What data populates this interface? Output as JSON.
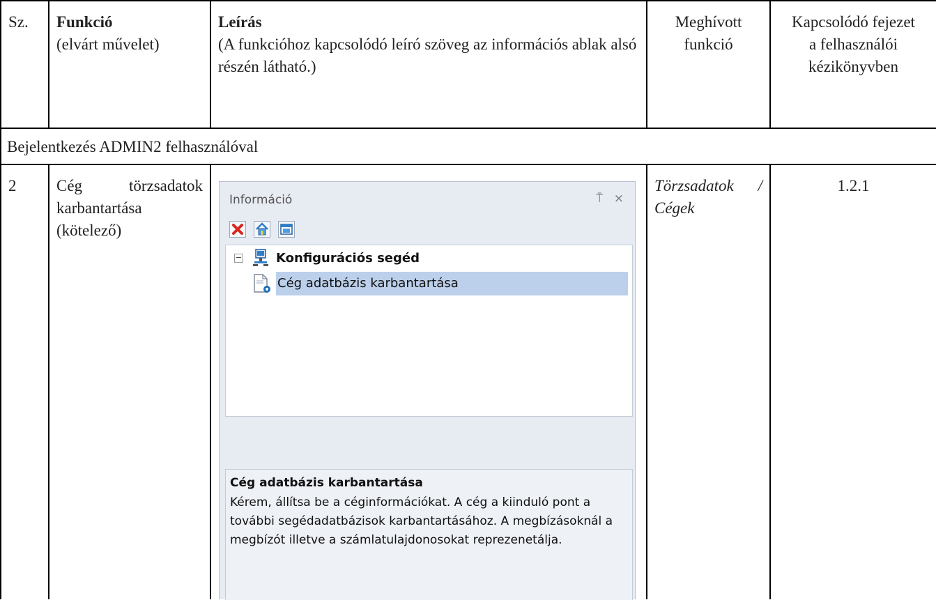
{
  "header": {
    "col_num": "Sz.",
    "col_function_title": "Funkció",
    "col_function_sub": "(elvárt művelet)",
    "col_desc_title": "Leírás",
    "col_desc_sub": "(A funkcióhoz kapcsolódó leíró szöveg az információs ablak alsó részén látható.)",
    "col_called": "Meghívott funkció",
    "col_chapter": "Kapcsolódó fejezet a felhasználói kézikönyvben"
  },
  "section_row": "Bejelentkezés ADMIN2 felhasználóval",
  "row": {
    "num": "2",
    "function_line1": "Cég törzsadatok",
    "function_line2": "karbantartása",
    "function_line3": "(kötelező)",
    "called_line1": "Törzsadatok /",
    "called_line2": "Cégek",
    "chapter": "1.2.1"
  },
  "panel": {
    "title": "Információ",
    "pin_glyph": "⍑",
    "close_glyph": "×",
    "toolbar_icons": [
      "delete-icon",
      "home-icon",
      "window-icon"
    ],
    "tree_root": "Konfigurációs segéd",
    "tree_child": "Cég adatbázis karbantartása",
    "expander_glyph": "−",
    "desc_title": "Cég adatbázis karbantartása",
    "desc_text": "Kérem, állítsa be a céginformációkat. A cég a kiinduló pont a további segédadatbázisok karbantartásához. A megbízásoknál a megbízót illetve a számlatulajdonosokat reprezenetálja."
  },
  "colors": {
    "selection": "#bcd0ec",
    "panel_bg": "#e7ebf2",
    "delete_red": "#d9261c"
  }
}
